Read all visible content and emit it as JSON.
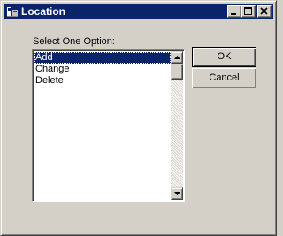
{
  "window": {
    "title": "Location",
    "icon": "location-app-icon",
    "controls": [
      "minimize-icon",
      "maximize-icon",
      "close-icon"
    ]
  },
  "dialog": {
    "prompt": "Select One Option:",
    "options": [
      "Add",
      "Change",
      "Delete"
    ],
    "selected": "Add"
  },
  "buttons": {
    "ok": "OK",
    "cancel": "Cancel"
  },
  "colors": {
    "titlebar": "#0a246a",
    "face": "#d4d0c8",
    "selection": "#0a246a"
  }
}
